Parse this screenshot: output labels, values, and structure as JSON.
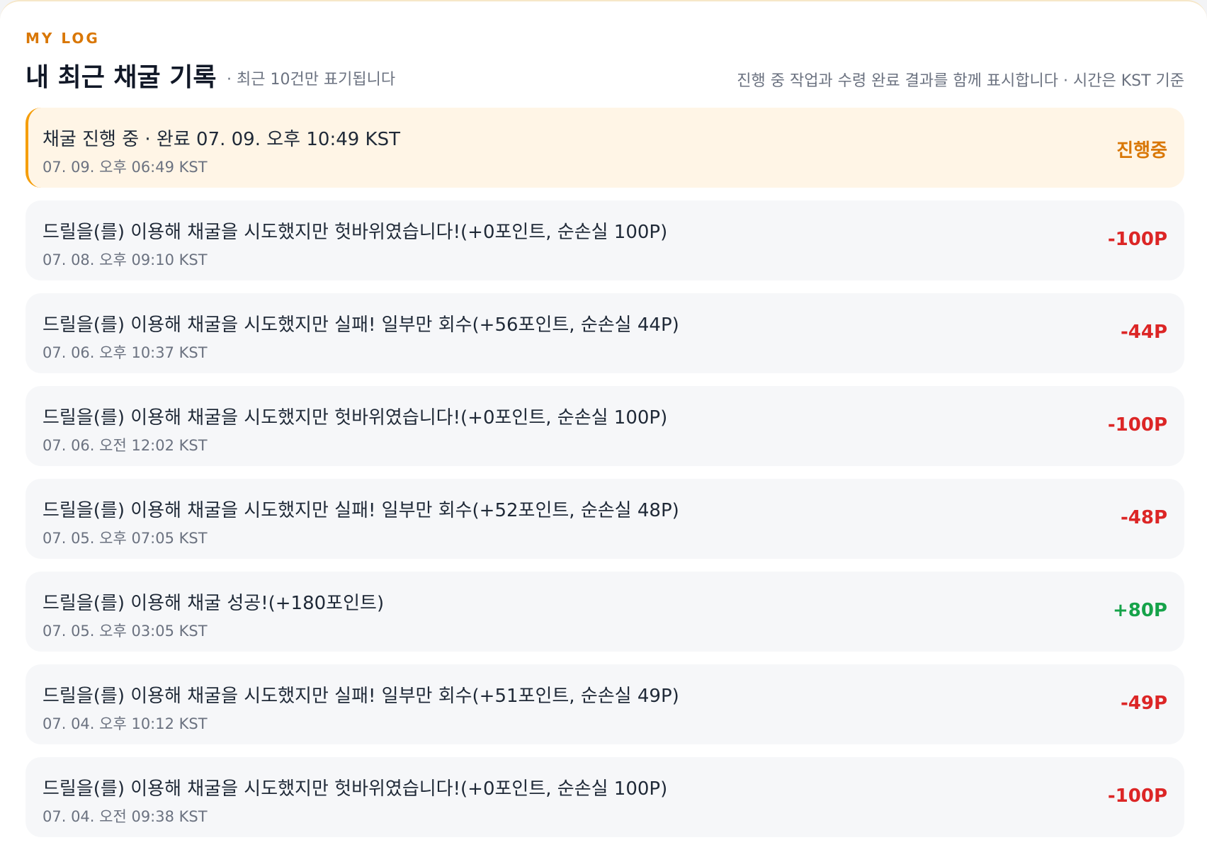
{
  "header": {
    "eyebrow": "MY LOG",
    "title": "내 최근 채굴 기록",
    "subtitle": "· 최근 10건만 표기됩니다",
    "note": "진행 중 작업과 수령 완료 결과를 함께 표시합니다 · 시간은 KST 기준"
  },
  "log": [
    {
      "title": "채굴 진행 중 · 완료 07. 09. 오후 10:49 KST",
      "time": "07. 09. 오후 06:49 KST",
      "amount": "진행중",
      "status": "pending"
    },
    {
      "title": "드릴을(를) 이용해 채굴을 시도했지만 헛바위였습니다!(+0포인트, 순손실 100P)",
      "time": "07. 08. 오후 09:10 KST",
      "amount": "-100P",
      "status": "negative"
    },
    {
      "title": "드릴을(를) 이용해 채굴을 시도했지만 실패! 일부만 회수(+56포인트, 순손실 44P)",
      "time": "07. 06. 오후 10:37 KST",
      "amount": "-44P",
      "status": "negative"
    },
    {
      "title": "드릴을(를) 이용해 채굴을 시도했지만 헛바위였습니다!(+0포인트, 순손실 100P)",
      "time": "07. 06. 오전 12:02 KST",
      "amount": "-100P",
      "status": "negative"
    },
    {
      "title": "드릴을(를) 이용해 채굴을 시도했지만 실패! 일부만 회수(+52포인트, 순손실 48P)",
      "time": "07. 05. 오후 07:05 KST",
      "amount": "-48P",
      "status": "negative"
    },
    {
      "title": "드릴을(를) 이용해 채굴 성공!(+180포인트)",
      "time": "07. 05. 오후 03:05 KST",
      "amount": "+80P",
      "status": "positive"
    },
    {
      "title": "드릴을(를) 이용해 채굴을 시도했지만 실패! 일부만 회수(+51포인트, 순손실 49P)",
      "time": "07. 04. 오후 10:12 KST",
      "amount": "-49P",
      "status": "negative"
    },
    {
      "title": "드릴을(를) 이용해 채굴을 시도했지만 헛바위였습니다!(+0포인트, 순손실 100P)",
      "time": "07. 04. 오전 09:38 KST",
      "amount": "-100P",
      "status": "negative"
    }
  ],
  "colors": {
    "accent": "#d97706",
    "negative": "#dc2626",
    "positive": "#16a34a",
    "active_bg": "#fff5e6"
  }
}
